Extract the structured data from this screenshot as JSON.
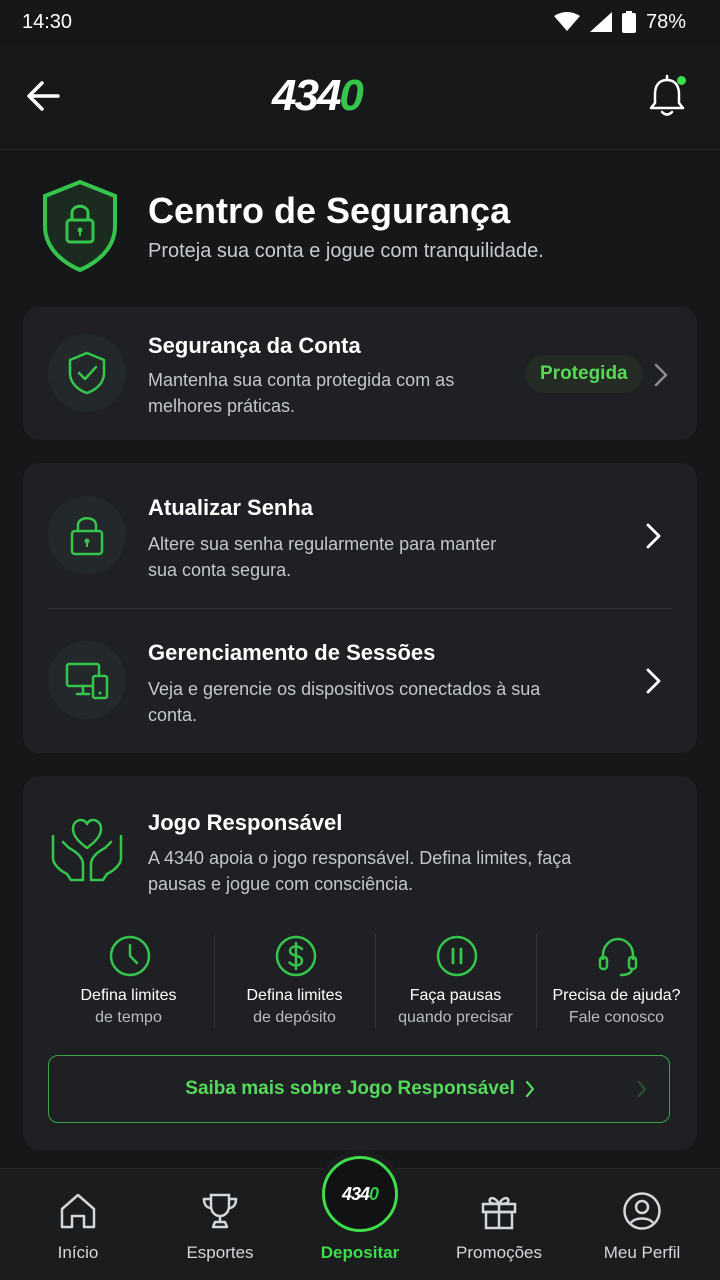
{
  "status": {
    "time": "14:30",
    "battery": "78%"
  },
  "header": {
    "logo_main": "434",
    "logo_accent": "0",
    "icons": {
      "back": "arrow-left-icon",
      "notifications": "bell-icon"
    }
  },
  "hero": {
    "title": "Centro de Segurança",
    "subtitle": "Proteja sua conta e jogue com tranquilidade."
  },
  "account_security": {
    "title": "Segurança da Conta",
    "description": "Mantenha sua conta protegida com as melhores práticas.",
    "badge": "Protegida"
  },
  "password": {
    "title": "Atualizar Senha",
    "description": "Altere sua senha regularmente para manter sua conta segura."
  },
  "sessions": {
    "title": "Gerenciamento de Sessões",
    "description": "Veja e gerencie os dispositivos conectados à sua conta."
  },
  "responsible": {
    "title": "Jogo Responsável",
    "description": "A 4340 apoia o jogo responsável. Defina limites, faça pausas e jogue com consciência.",
    "features": [
      {
        "line1": "Defina limites",
        "line2": "de tempo",
        "icon": "clock-icon"
      },
      {
        "line1": "Defina limites",
        "line2": "de depósito",
        "icon": "dollar-icon"
      },
      {
        "line1": "Faça pausas",
        "line2": "quando precisar",
        "icon": "pause-icon"
      },
      {
        "line1": "Precisa de ajuda?",
        "line2": "Fale conosco",
        "icon": "headset-icon"
      }
    ],
    "cta": "Saiba mais sobre Jogo Responsável"
  },
  "nav": {
    "items": [
      {
        "label": "Início",
        "icon": "home-icon"
      },
      {
        "label": "Esportes",
        "icon": "trophy-icon"
      },
      {
        "label": "Depositar",
        "icon": "deposit-logo-icon"
      },
      {
        "label": "Promoções",
        "icon": "gift-icon"
      },
      {
        "label": "Meu Perfil",
        "icon": "user-icon"
      }
    ],
    "active_index": 2
  },
  "colors": {
    "accent": "#3ddc4a",
    "background": "#151719",
    "card": "#1e2023"
  }
}
